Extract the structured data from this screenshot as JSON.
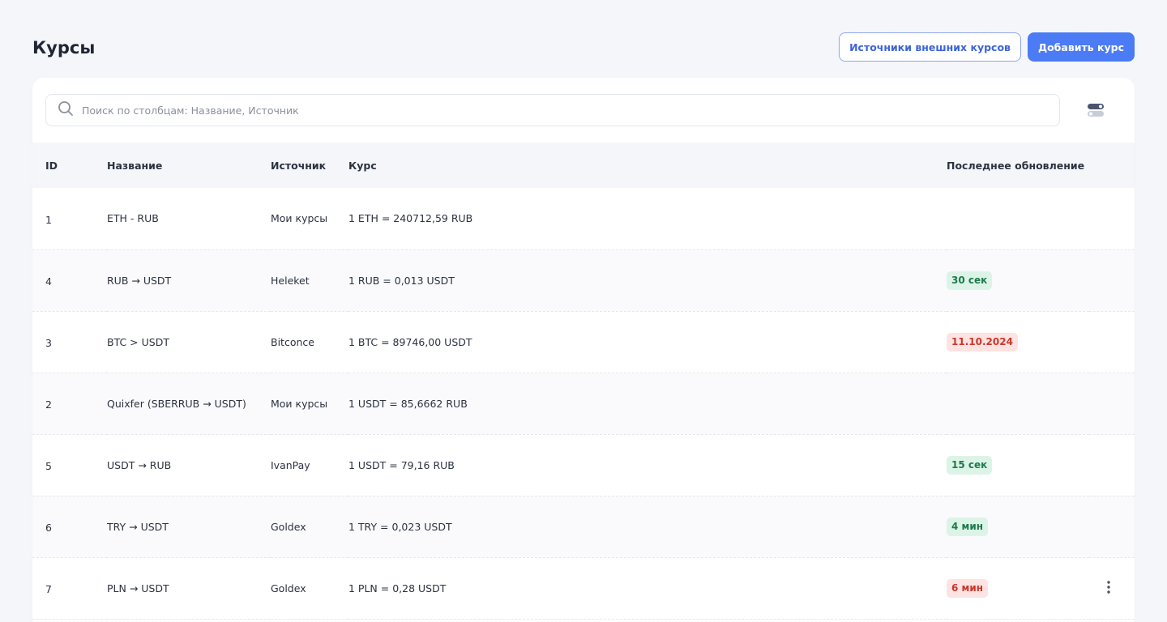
{
  "header": {
    "title": "Курсы",
    "external_sources_label": "Источники внешних курсов",
    "add_rate_label": "Добавить курс"
  },
  "search": {
    "placeholder": "Поиск по столбцам: Название, Источник",
    "value": ""
  },
  "icons": {
    "search": "search-icon",
    "toggle": "columns-toggle-icon",
    "row_menu": "more-vertical-icon"
  },
  "colors": {
    "primary": "#4b7bf5",
    "badge_green_bg": "#dcf4e7",
    "badge_green_text": "#1e7a4a",
    "badge_red_bg": "#fde3e1",
    "badge_red_text": "#c9382c"
  },
  "table": {
    "columns": [
      "ID",
      "Название",
      "Источник",
      "Курс",
      "Последнее обновление"
    ],
    "rows": [
      {
        "id": "1",
        "name": "ETH - RUB",
        "source": "Мои курсы",
        "rate": "1  ETH = 240712,59  RUB",
        "updated": "",
        "status": ""
      },
      {
        "id": "4",
        "name": "RUB → USDT",
        "source": "Heleket",
        "rate": "1 RUB = 0,013 USDT",
        "updated": "30 сек",
        "status": "green"
      },
      {
        "id": "3",
        "name": "BTC > USDT",
        "source": "Bitconce",
        "rate": "1 BTC = 89746,00  USDT",
        "updated": "11.10.2024",
        "status": "red"
      },
      {
        "id": "2",
        "name": "Quixfer (SBERRUB → USDT)",
        "source": "Мои курсы",
        "rate": "1 USDT = 85,6662 RUB",
        "updated": "",
        "status": ""
      },
      {
        "id": "5",
        "name": "USDT → RUB",
        "source": "IvanPay",
        "rate": "1 USDT = 79,16  RUB",
        "updated": "15 сек",
        "status": "green"
      },
      {
        "id": "6",
        "name": "TRY → USDT",
        "source": "Goldex",
        "rate": "1 TRY = 0,023 USDT",
        "updated": "4 мин",
        "status": "green"
      },
      {
        "id": "7",
        "name": "PLN → USDT",
        "source": "Goldex",
        "rate": "1 PLN = 0,28 USDT",
        "updated": "6 мин",
        "status": "red",
        "menu": true
      }
    ]
  }
}
